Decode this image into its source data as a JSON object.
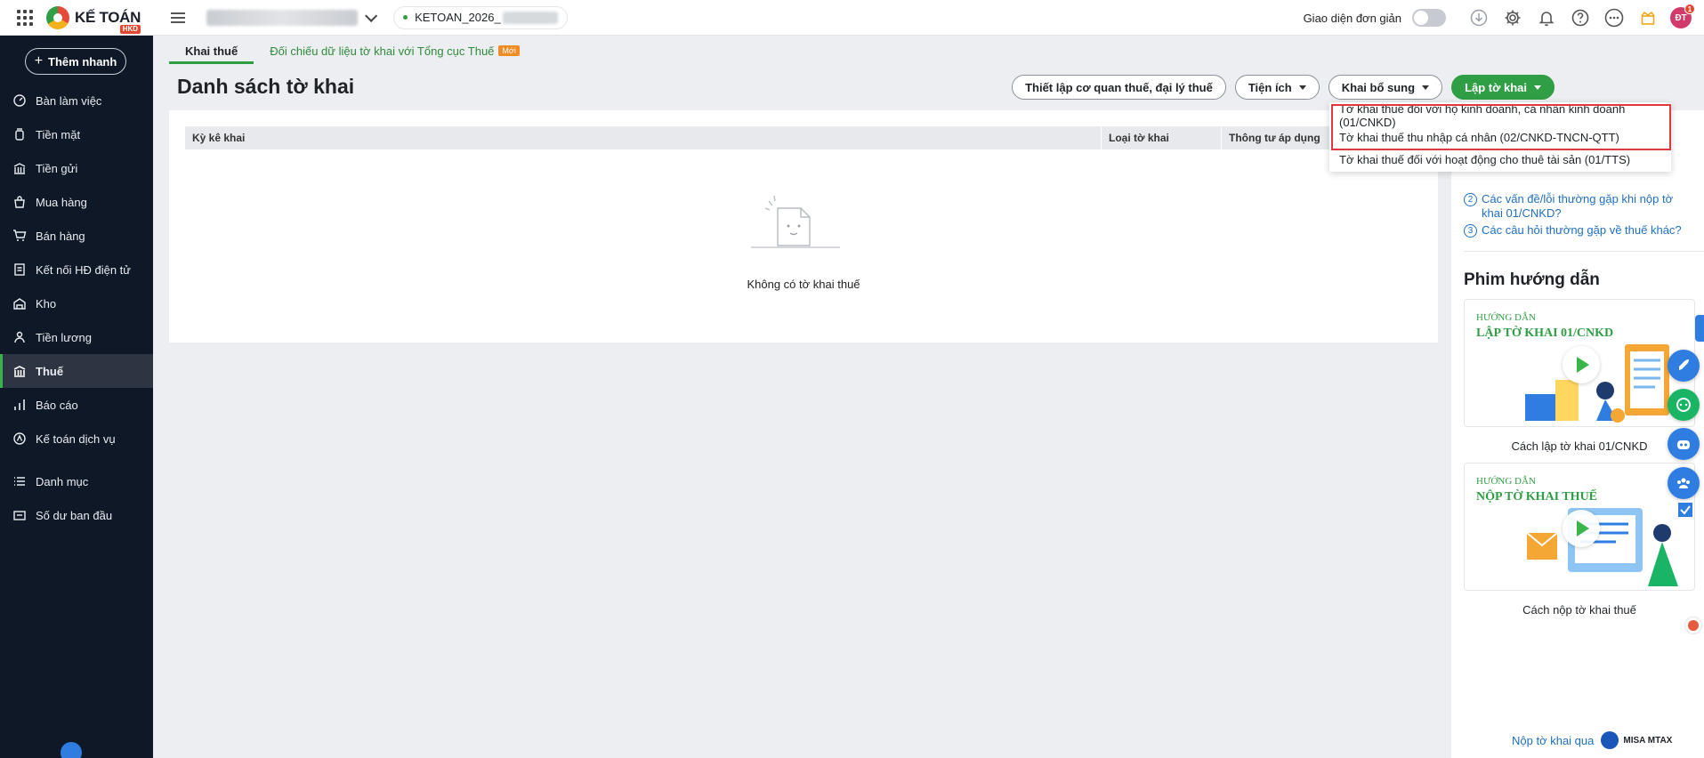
{
  "header": {
    "logo_text": "KẾ TOÁN",
    "logo_badge": "HKD",
    "db_name": "KETOAN_2026_",
    "simple_mode_label": "Giao diện đơn giản",
    "avatar_initials": "ĐT",
    "notification_count": "1"
  },
  "sidebar": {
    "quick_add_label": "Thêm nhanh",
    "items": [
      {
        "label": "Bàn làm việc"
      },
      {
        "label": "Tiền mặt"
      },
      {
        "label": "Tiền gửi"
      },
      {
        "label": "Mua hàng"
      },
      {
        "label": "Bán hàng"
      },
      {
        "label": "Kết nối HĐ điện tử"
      },
      {
        "label": "Kho"
      },
      {
        "label": "Tiền lương"
      },
      {
        "label": "Thuế"
      },
      {
        "label": "Báo cáo"
      },
      {
        "label": "Kế toán dịch vụ"
      },
      {
        "label": "Danh mục"
      },
      {
        "label": "Số dư ban đầu"
      }
    ]
  },
  "tabs": {
    "tax_return": "Khai thuế",
    "reconcile": "Đối chiếu dữ liệu tờ khai với Tổng cục Thuế",
    "new_badge": "Mới"
  },
  "page": {
    "title": "Danh sách tờ khai",
    "empty_text": "Không có tờ khai thuế"
  },
  "actions": {
    "setup": "Thiết lập cơ quan thuế, đại lý thuế",
    "utilities": "Tiện ích",
    "supplement": "Khai bổ sung",
    "create": "Lập tờ khai"
  },
  "table": {
    "columns": [
      "Kỳ kê khai",
      "Loại tờ khai",
      "Thông tư áp dụng"
    ]
  },
  "dropdown": {
    "items": [
      "Tờ khai thuế đối với hộ kinh doanh, cá nhân kinh doanh (01/CNKD)",
      "Tờ khai thuế thu nhập cá nhân (02/CNKD-TNCN-QTT)",
      "Tờ khai thuế đối với hoạt động cho thuê tài sản (01/TTS)"
    ]
  },
  "help": {
    "faq": [
      {
        "num": "2",
        "text": "Các vấn đề/lỗi thường gặp khi nộp tờ khai 01/CNKD?"
      },
      {
        "num": "3",
        "text": "Các câu hỏi thường gặp về thuế khác?"
      }
    ],
    "films_title": "Phim hướng dẫn",
    "videos": [
      {
        "small": "HƯỚNG DẪN",
        "big": "LẬP TỜ KHAI 01/CNKD",
        "caption": "Cách lập tờ khai 01/CNKD"
      },
      {
        "small": "HƯỚNG DẪN",
        "big": "NỘP TỜ KHAI THUẾ",
        "caption": "Cách nộp tờ khai thuế"
      }
    ],
    "mtax_text": "Nộp tờ khai qua",
    "mtax_brand": "MISA MTAX"
  },
  "colors": {
    "accent": "#2f9e44",
    "sidebar_bg": "#0f1826",
    "link": "#1f6fc2",
    "highlight": "#e0383e"
  }
}
